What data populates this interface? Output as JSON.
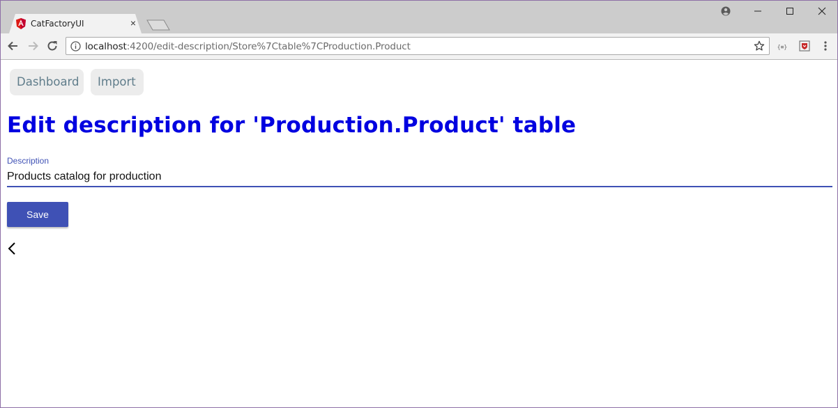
{
  "browser": {
    "tab_title": "CatFactoryUI",
    "url_host": "localhost",
    "url_path": ":4200/edit-description/Store%7Ctable%7CProduction.Product",
    "tab_close_glyph": "×"
  },
  "nav": {
    "dashboard_label": "Dashboard",
    "import_label": "Import"
  },
  "page": {
    "title": "Edit description for 'Production.Product' table",
    "description_label": "Description",
    "description_value": "Products catalog for production",
    "save_label": "Save"
  },
  "colors": {
    "heading": "#0000e0",
    "accent": "#3f51b5",
    "nav_text": "#607d8b"
  },
  "icons": {
    "favicon": "angular-icon",
    "back": "chevron-left-icon"
  }
}
